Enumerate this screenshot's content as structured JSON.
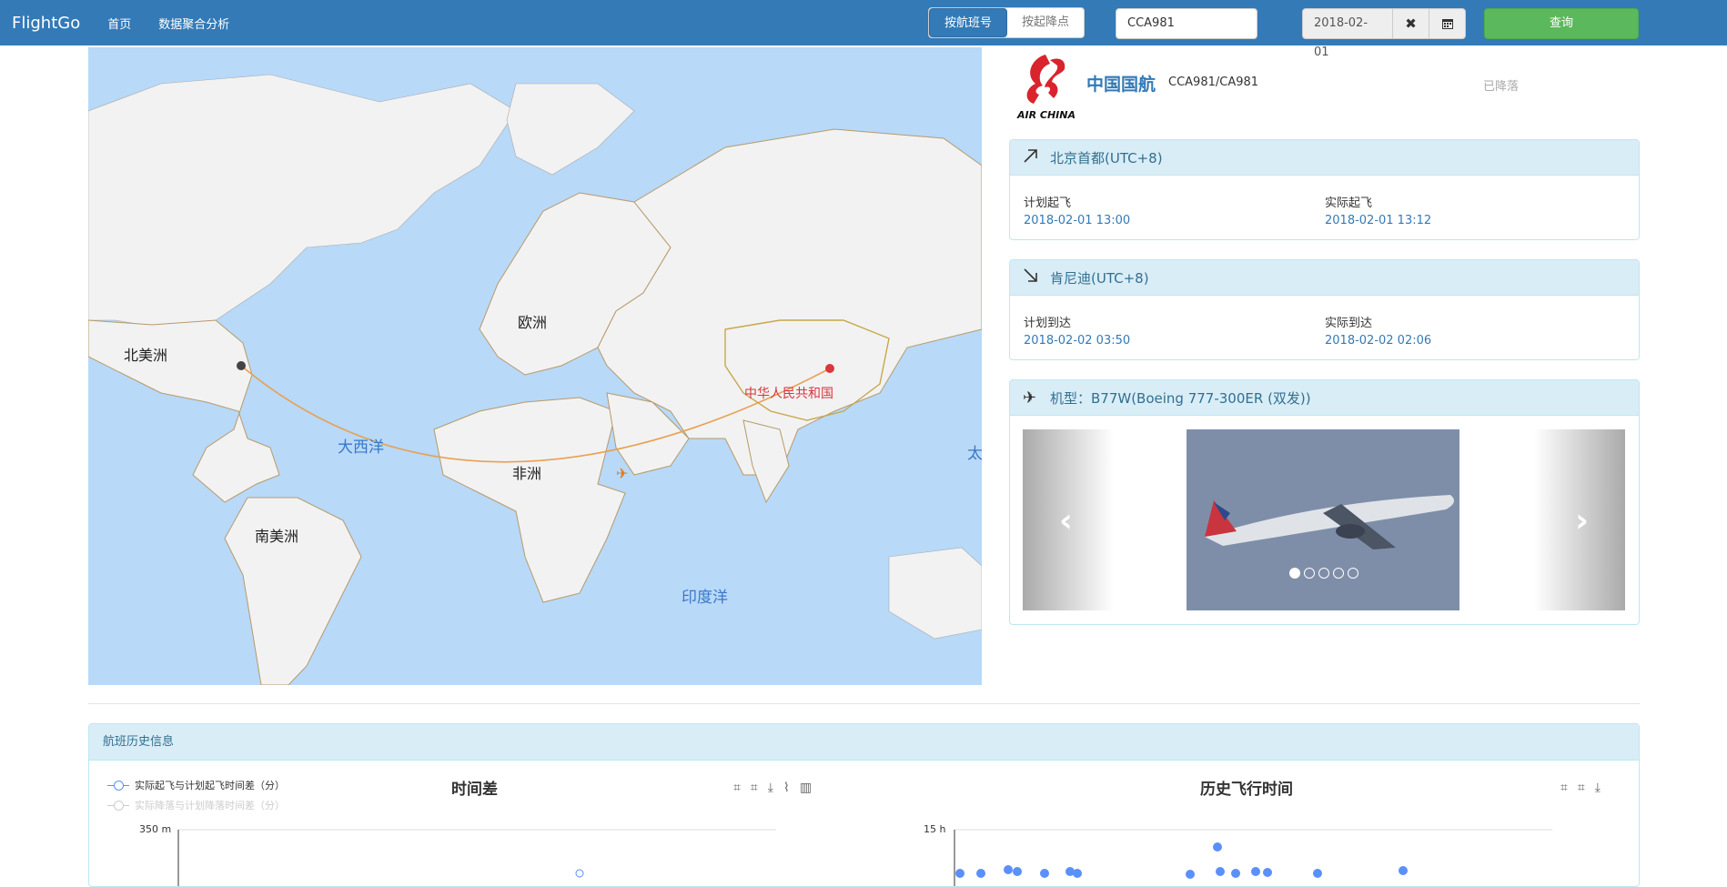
{
  "nav": {
    "brand": "FlightGo",
    "links": [
      "首页",
      "数据聚合分析"
    ],
    "mode_options": [
      "按航班号",
      "按起降点"
    ],
    "flight_number": "CCA981",
    "date": "2018-02-01",
    "clear_icon": "✖",
    "calendar_icon": "calendar-icon",
    "query_label": "查询"
  },
  "map": {
    "continents": [
      "北美洲",
      "欧洲",
      "非洲",
      "南美洲"
    ],
    "oceans": [
      "大西洋",
      "印度洋",
      "太"
    ],
    "country_label": "中华人民共和国"
  },
  "flight": {
    "airline": "中国国航",
    "code": "CCA981/CA981",
    "status": "已降落",
    "logo_text": "AIR CHINA"
  },
  "departure": {
    "airport": "北京首都(UTC+8)",
    "sched_label": "计划起飞",
    "sched_time": "2018-02-01 13:00",
    "actual_label": "实际起飞",
    "actual_time": "2018-02-01 13:12"
  },
  "arrival": {
    "airport": "肯尼迪(UTC+8)",
    "sched_label": "计划到达",
    "sched_time": "2018-02-02 03:50",
    "actual_label": "实际到达",
    "actual_time": "2018-02-02 02:06"
  },
  "aircraft": {
    "label": "机型：B77W(Boeing 777-300ER (双发))",
    "slide_count": 5,
    "active_slide": 0
  },
  "history": {
    "title": "航班历史信息",
    "legend": [
      "实际起飞与计划起飞时间差（分）",
      "实际降落与计划降落时间差（分）"
    ],
    "chart1_title": "时间差",
    "chart2_title": "历史飞行时间",
    "chart1_ymax": "350 m",
    "chart2_ymax": "15 h"
  },
  "colors": {
    "nav_bg": "#337ab7",
    "query_btn": "#5cb85c",
    "route": "#e8a050",
    "panel_head": "#d9edf7",
    "series": "#5b8ff9"
  }
}
